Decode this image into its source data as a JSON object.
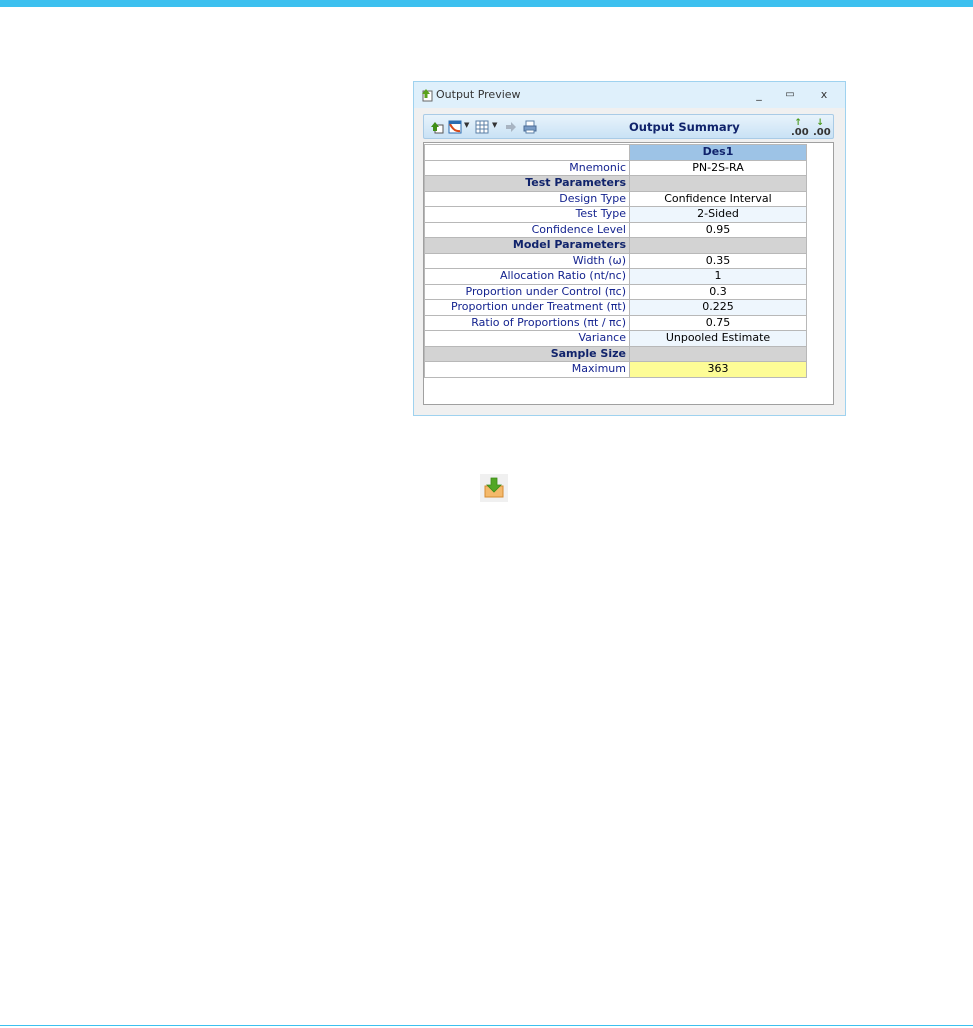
{
  "window": {
    "title": "Output Preview",
    "controls": {
      "minimize": "_",
      "maximize": "▭",
      "close": "x"
    }
  },
  "toolbar": {
    "title": "Output Summary",
    "icons": [
      "export-icon",
      "chart-icon",
      "table-icon",
      "arrows-icon",
      "print-icon",
      "increase-decimal-icon",
      "decrease-decimal-icon"
    ],
    "decimal_label": ".00"
  },
  "summary": {
    "column_header": "Des1",
    "rows": [
      {
        "type": "row",
        "label": "Mnemonic",
        "value": "PN-2S-RA"
      },
      {
        "type": "section",
        "label": "Test Parameters"
      },
      {
        "type": "row",
        "label": "Design Type",
        "value": "Confidence Interval"
      },
      {
        "type": "row",
        "label": "Test Type",
        "value": "2-Sided"
      },
      {
        "type": "row",
        "label": "Confidence Level",
        "value": "0.95"
      },
      {
        "type": "section",
        "label": "Model Parameters"
      },
      {
        "type": "row",
        "label": "Width (ω)",
        "value": "0.35"
      },
      {
        "type": "row",
        "label": "Allocation Ratio (nt/nc)",
        "value": "1"
      },
      {
        "type": "row",
        "label": "Proportion under Control (πc)",
        "value": "0.3"
      },
      {
        "type": "row",
        "label": "Proportion under Treatment (πt)",
        "value": "0.225"
      },
      {
        "type": "row",
        "label": "Ratio of Proportions (πt / πc)",
        "value": "0.75"
      },
      {
        "type": "row",
        "label": "Variance",
        "value": "Unpooled Estimate"
      },
      {
        "type": "section",
        "label": "Sample Size"
      },
      {
        "type": "row",
        "label": "Maximum",
        "value": "363",
        "highlight": true
      }
    ]
  },
  "colors": {
    "accent": "#3cc0ef",
    "header_blue": "#9dc3e6",
    "label_text": "#14238f",
    "highlight": "#fdfc96"
  },
  "floating_icon": "download-icon"
}
